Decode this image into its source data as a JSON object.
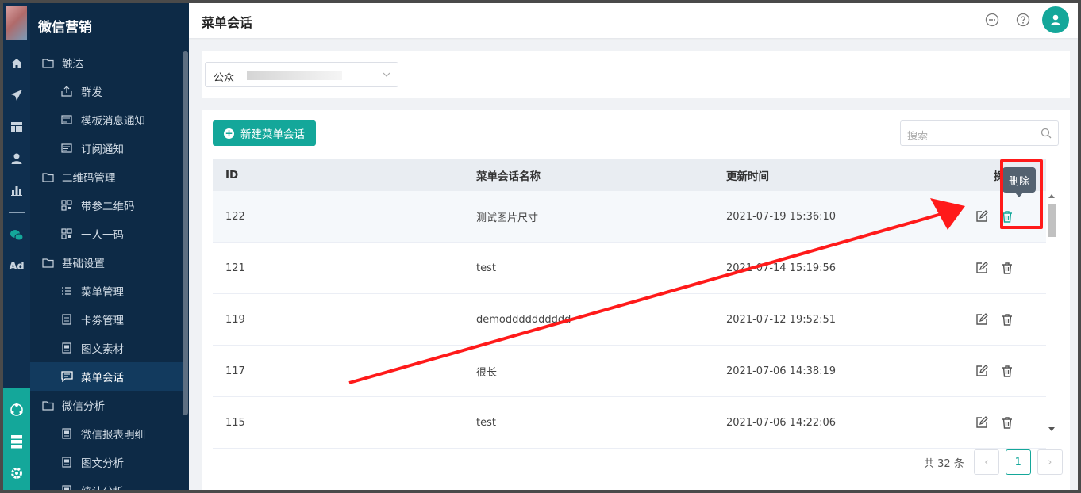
{
  "app": {
    "brand": "微信营销",
    "page_title": "菜单会话"
  },
  "rail": {
    "icons": [
      "home-icon",
      "send-icon",
      "layout-icon",
      "user-icon",
      "bar-chart-icon",
      "wechat-icon",
      "ad-icon",
      "hub-icon",
      "server-icon",
      "gear-icon"
    ],
    "ad_label": "Ad"
  },
  "menu": {
    "items": [
      {
        "label": "触达",
        "level": 1,
        "icon": "folder-icon"
      },
      {
        "label": "群发",
        "level": 2,
        "icon": "upload-icon"
      },
      {
        "label": "模板消息通知",
        "level": 2,
        "icon": "template-icon"
      },
      {
        "label": "订阅通知",
        "level": 2,
        "icon": "template-icon"
      },
      {
        "label": "二维码管理",
        "level": 1,
        "icon": "folder-icon"
      },
      {
        "label": "带参二维码",
        "level": 2,
        "icon": "qr-icon"
      },
      {
        "label": "一人一码",
        "level": 2,
        "icon": "qr-icon"
      },
      {
        "label": "基础设置",
        "level": 1,
        "icon": "folder-icon"
      },
      {
        "label": "菜单管理",
        "level": 2,
        "icon": "list-icon"
      },
      {
        "label": "卡劵管理",
        "level": 2,
        "icon": "card-icon"
      },
      {
        "label": "图文素材",
        "level": 2,
        "icon": "doc-icon"
      },
      {
        "label": "菜单会话",
        "level": 2,
        "icon": "chat-icon",
        "active": true
      },
      {
        "label": "微信分析",
        "level": 1,
        "icon": "folder-icon"
      },
      {
        "label": "微信报表明细",
        "level": 2,
        "icon": "doc-icon"
      },
      {
        "label": "图文分析",
        "level": 2,
        "icon": "doc-icon"
      },
      {
        "label": "统计分析",
        "level": 2,
        "icon": "doc-icon"
      }
    ]
  },
  "filter": {
    "account_label": "公众"
  },
  "toolbar": {
    "new_button": "新建菜单会话",
    "search_placeholder": "搜索"
  },
  "table": {
    "columns": [
      "ID",
      "菜单会话名称",
      "更新时间",
      "操作"
    ],
    "rows": [
      {
        "id": "122",
        "name": "测试图片尺寸",
        "updated": "2021-07-19 15:36:10"
      },
      {
        "id": "121",
        "name": "test",
        "updated": "2021-07-14 15:19:56"
      },
      {
        "id": "119",
        "name": "demodddddddddd",
        "updated": "2021-07-12 19:52:51"
      },
      {
        "id": "117",
        "name": "很长",
        "updated": "2021-07-06 14:38:19"
      },
      {
        "id": "115",
        "name": "test",
        "updated": "2021-07-06 14:22:06"
      }
    ]
  },
  "tooltip": {
    "delete": "删除"
  },
  "pagination": {
    "total": "共 32 条",
    "current": "1",
    "prev": "‹",
    "next": "›"
  },
  "colors": {
    "accent": "#14a79a",
    "sidebar": "#0d2a46",
    "annotation": "#ff1a1a"
  }
}
